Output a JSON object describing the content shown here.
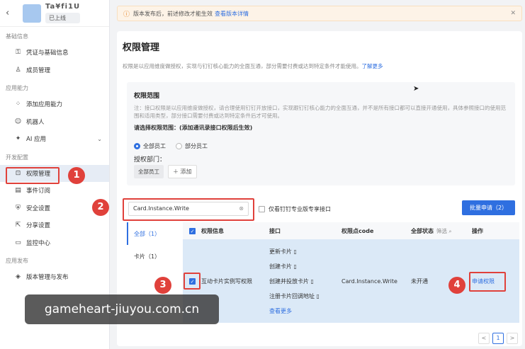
{
  "app": {
    "name": "Ta¥fi1U",
    "status": "已上线"
  },
  "sidebar": {
    "sections": [
      {
        "title": "基础信息",
        "items": [
          {
            "label": "凭证与基础信息",
            "icon": "key-icon"
          },
          {
            "label": "成员管理",
            "icon": "person-icon"
          }
        ]
      },
      {
        "title": "应用能力",
        "items": [
          {
            "label": "添加应用能力",
            "icon": "grid-icon"
          },
          {
            "label": "机器人",
            "icon": "robot-icon"
          },
          {
            "label": "AI 应用",
            "icon": "ai-icon"
          }
        ]
      },
      {
        "title": "开发配置",
        "items": [
          {
            "label": "权限管理",
            "icon": "permission-icon"
          },
          {
            "label": "事件订阅",
            "icon": "event-icon"
          },
          {
            "label": "安全设置",
            "icon": "shield-icon"
          },
          {
            "label": "分享设置",
            "icon": "share-icon"
          },
          {
            "label": "监控中心",
            "icon": "monitor-icon"
          }
        ]
      },
      {
        "title": "应用发布",
        "items": [
          {
            "label": "版本管理与发布",
            "icon": "version-icon"
          }
        ]
      }
    ]
  },
  "notice": {
    "text": "版本发布后，前述修改才能生效",
    "link": "查看版本详情"
  },
  "page": {
    "title": "权限管理",
    "desc": "权限是以应用维度做授权，实现与钉钉核心能力的全面互通，部分需要付费或达到特定条件才能使用。",
    "desc_link": "了解更多"
  },
  "scope": {
    "title": "权限范围",
    "note": "注：接口权限是以应用维度做授权，请合理使用钉钉开放接口，实现跟钉钉核心能力的全面互通，并不是所有接口都可以直接开通使用，具体参照接口的使用范围和适用类型，部分接口需要付费或达到特定条件后才可使用。",
    "pick_label": "请选择权限范围：(添加通讯录接口权限后生效)",
    "radio_all": "全部员工",
    "radio_part": "部分员工",
    "dept_label": "授权部门：",
    "dept_chip": "全部员工",
    "add_label": "＋ 添加"
  },
  "toolbar": {
    "search_value": "Card.Instance.Write",
    "only_pro_label": "仅看钉钉专业版专享接口",
    "batch_label": "批量申请（2）"
  },
  "filters": [
    {
      "label": "全部（1）"
    },
    {
      "label": "卡片（1）"
    }
  ],
  "table": {
    "headers": {
      "info": "权限信息",
      "api": "接口",
      "code": "权限点code",
      "status": "全部状态",
      "filter": "筛选",
      "op": "操作"
    },
    "row": {
      "info": "互动卡片实例写权限",
      "apis": [
        "更新卡片",
        "创建卡片",
        "创建并投放卡片",
        "注册卡片回调地址"
      ],
      "more": "查看更多",
      "code": "Card.Instance.Write",
      "status": "未开通",
      "op": "申请权限"
    }
  },
  "pager": {
    "prev": "<",
    "current": "1",
    "next": ">"
  },
  "annotations": [
    "1",
    "2",
    "3",
    "4"
  ],
  "watermark": "gameheart-jiuyou.com.cn"
}
